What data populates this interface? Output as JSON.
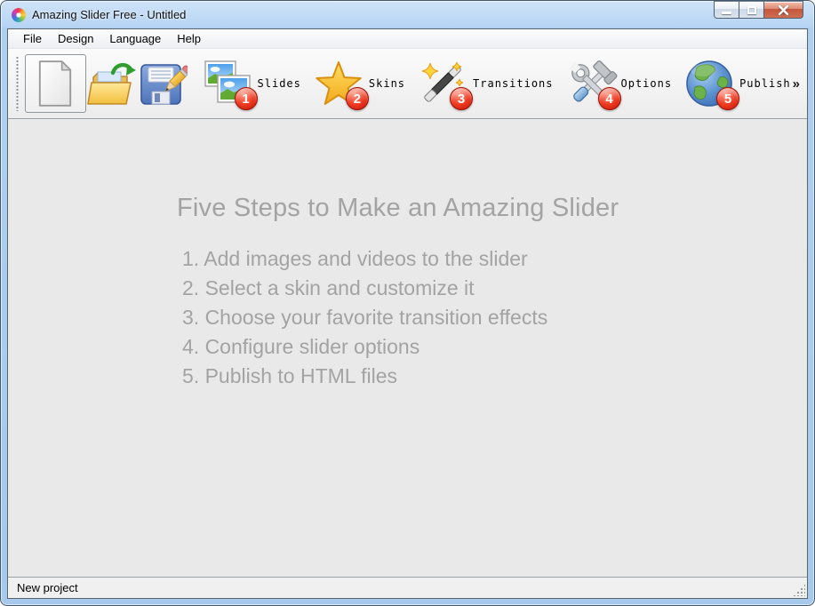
{
  "window": {
    "title": "Amazing Slider Free - Untitled"
  },
  "icons": {
    "app": "pinwheel-flower-icon",
    "minimize": "minimize-icon",
    "maximize": "maximize-icon",
    "close": "close-icon",
    "new": "blank-page-icon",
    "open": "open-folder-arrow-icon",
    "save": "floppy-disk-pencil-icon",
    "slides": "photo-stack-icon",
    "skins": "star-icon",
    "transitions": "magic-wand-icon",
    "options": "wrench-hammer-icon",
    "publish": "globe-icon"
  },
  "menu_bar": {
    "items": [
      {
        "label": "File"
      },
      {
        "label": "Design"
      },
      {
        "label": "Language"
      },
      {
        "label": "Help"
      }
    ]
  },
  "toolbar": {
    "overflow_chevron": "»",
    "steps": [
      {
        "label": "Slides",
        "badge": "1"
      },
      {
        "label": "Skins",
        "badge": "2"
      },
      {
        "label": "Transitions",
        "badge": "3"
      },
      {
        "label": "Options",
        "badge": "4"
      },
      {
        "label": "Publish",
        "badge": "5"
      }
    ]
  },
  "main": {
    "heading": "Five Steps to Make an Amazing Slider",
    "steps": [
      "1. Add images and videos to the slider",
      "2. Select a skin and customize it",
      "3. Choose your favorite transition effects",
      "4. Configure slider options",
      "5. Publish to HTML files"
    ]
  },
  "status_bar": {
    "text": "New project"
  },
  "colors": {
    "titlebar_blue": "#b5d4f3",
    "badge_red": "#ee3b22",
    "star_gold": "#fbc92a",
    "content_bg": "#e9e9e9",
    "content_text": "#a3a3a3",
    "toolbar_bg": "#f2f2f2",
    "close_button_red": "#c4563c"
  }
}
